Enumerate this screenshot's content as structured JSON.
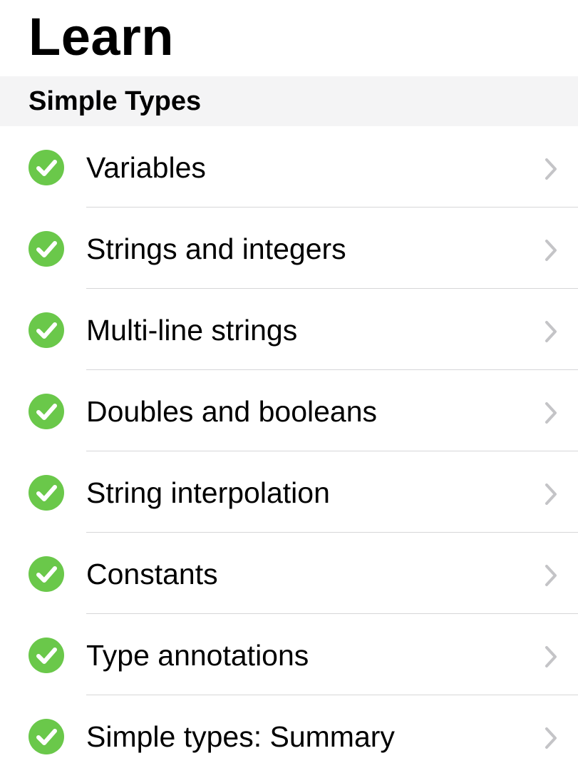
{
  "page": {
    "title": "Learn"
  },
  "section": {
    "title": "Simple Types"
  },
  "items": [
    {
      "label": "Variables",
      "completed": true
    },
    {
      "label": "Strings and integers",
      "completed": true
    },
    {
      "label": "Multi-line strings",
      "completed": true
    },
    {
      "label": "Doubles and booleans",
      "completed": true
    },
    {
      "label": "String interpolation",
      "completed": true
    },
    {
      "label": "Constants",
      "completed": true
    },
    {
      "label": "Type annotations",
      "completed": true
    },
    {
      "label": "Simple types: Summary",
      "completed": true
    }
  ],
  "icons": {
    "status": "checkmark-circle-icon",
    "disclosure": "chevron-right-icon"
  },
  "colors": {
    "check": "#6ac84a",
    "chevron": "#c4c4c7",
    "section_background": "#f4f4f5",
    "divider": "#d6d6d8"
  }
}
